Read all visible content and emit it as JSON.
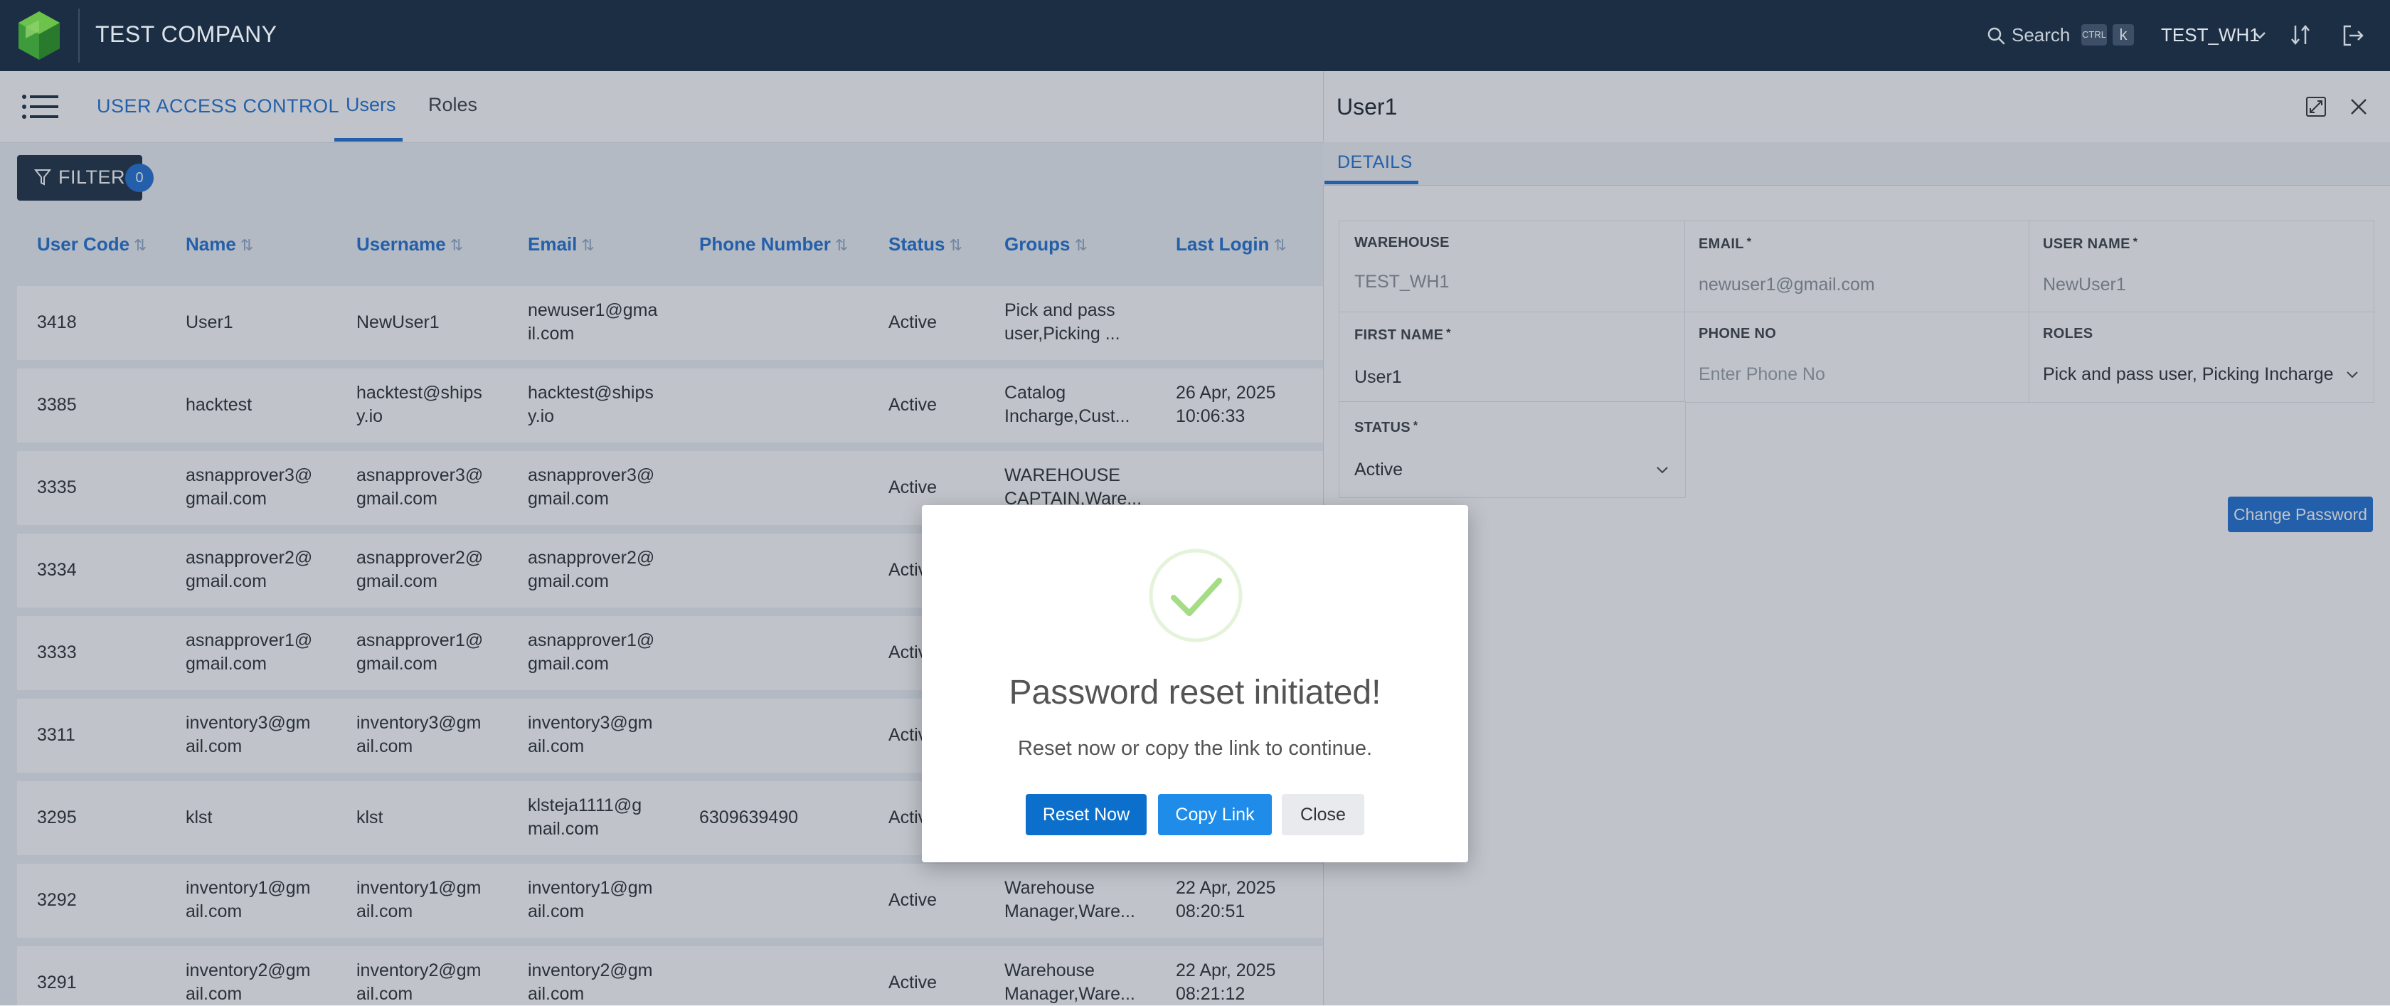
{
  "header": {
    "company": "TEST COMPANY",
    "search_label": "Search",
    "shortcut_ctrl": "CTRL",
    "shortcut_key": "k",
    "warehouse": "TEST_WH1"
  },
  "subheader": {
    "module_title": "USER ACCESS CONTROL",
    "tabs": [
      {
        "label": "Users",
        "active": true
      },
      {
        "label": "Roles",
        "active": false
      }
    ]
  },
  "filter": {
    "label": "FILTER",
    "count": "0"
  },
  "table": {
    "columns": [
      "User Code",
      "Name",
      "Username",
      "Email",
      "Phone Number",
      "Status",
      "Groups",
      "Last Login"
    ],
    "sort_indicator": "⇅",
    "rows": [
      {
        "code": "3418",
        "name": "User1",
        "username": "NewUser1",
        "email": "newuser1@gma\nil.com",
        "phone": "",
        "status": "Active",
        "groups": "Pick and pass\nuser,Picking ...",
        "last_login": ""
      },
      {
        "code": "3385",
        "name": "hacktest",
        "username": "hacktest@ships\ny.io",
        "email": "hacktest@ships\ny.io",
        "phone": "",
        "status": "Active",
        "groups": "Catalog\nIncharge,Cust...",
        "last_login": "26 Apr, 2025\n10:06:33"
      },
      {
        "code": "3335",
        "name": "asnapprover3@\ngmail.com",
        "username": "asnapprover3@\ngmail.com",
        "email": "asnapprover3@\ngmail.com",
        "phone": "",
        "status": "Active",
        "groups": "WAREHOUSE\nCAPTAIN,Ware...",
        "last_login": ""
      },
      {
        "code": "3334",
        "name": "asnapprover2@\ngmail.com",
        "username": "asnapprover2@\ngmail.com",
        "email": "asnapprover2@\ngmail.com",
        "phone": "",
        "status": "Active",
        "groups": "",
        "last_login": ""
      },
      {
        "code": "3333",
        "name": "asnapprover1@\ngmail.com",
        "username": "asnapprover1@\ngmail.com",
        "email": "asnapprover1@\ngmail.com",
        "phone": "",
        "status": "Active",
        "groups": "",
        "last_login": ""
      },
      {
        "code": "3311",
        "name": "inventory3@gm\nail.com",
        "username": "inventory3@gm\nail.com",
        "email": "inventory3@gm\nail.com",
        "phone": "",
        "status": "Active",
        "groups": "",
        "last_login": ""
      },
      {
        "code": "3295",
        "name": "klst",
        "username": "klst",
        "email": "klsteja1111@g\nmail.com",
        "phone": "6309639490",
        "status": "Active",
        "groups": "",
        "last_login": ""
      },
      {
        "code": "3292",
        "name": "inventory1@gm\nail.com",
        "username": "inventory1@gm\nail.com",
        "email": "inventory1@gm\nail.com",
        "phone": "",
        "status": "Active",
        "groups": "Warehouse\nManager,Ware...",
        "last_login": "22 Apr, 2025\n08:20:51"
      },
      {
        "code": "3291",
        "name": "inventory2@gm\nail.com",
        "username": "inventory2@gm\nail.com",
        "email": "inventory2@gm\nail.com",
        "phone": "",
        "status": "Active",
        "groups": "Warehouse\nManager,Ware...",
        "last_login": "22 Apr, 2025\n08:21:12"
      }
    ]
  },
  "panel": {
    "title": "User1",
    "tab": "DETAILS",
    "fields": {
      "warehouse": {
        "label": "WAREHOUSE",
        "value": "TEST_WH1"
      },
      "email": {
        "label": "EMAIL",
        "value": "newuser1@gmail.com"
      },
      "username": {
        "label": "USER NAME",
        "value": "NewUser1"
      },
      "first_name": {
        "label": "FIRST NAME",
        "value": "User1"
      },
      "phone": {
        "label": "PHONE NO",
        "placeholder": "Enter Phone No"
      },
      "roles": {
        "label": "ROLES",
        "value": "Pick and pass user, Picking Incharge,"
      },
      "status": {
        "label": "STATUS",
        "value": "Active"
      }
    },
    "required_mark": "*",
    "change_password": "Change Password"
  },
  "modal": {
    "title": "Password reset initiated!",
    "text": "Reset now or copy the link to continue.",
    "buttons": {
      "reset": "Reset Now",
      "copy": "Copy Link",
      "close": "Close"
    }
  },
  "colors": {
    "topbar": "#1c2e44",
    "accent": "#1f6fd1",
    "success": "#a5dc86",
    "copy_button": "#1e8ce8"
  }
}
